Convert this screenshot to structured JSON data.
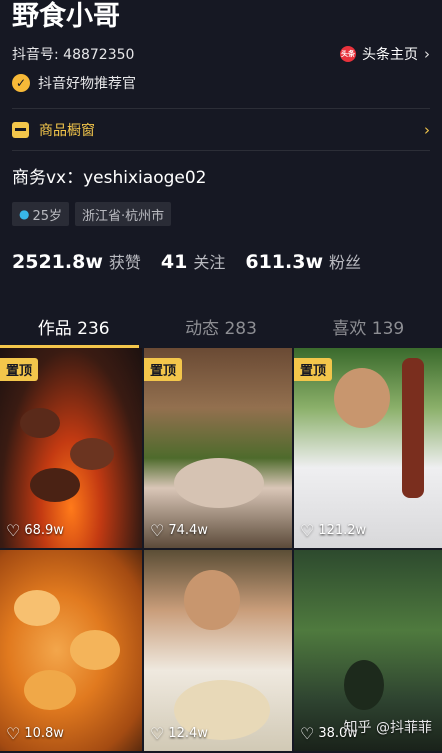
{
  "profile": {
    "name": "野食小哥",
    "account_id": "抖音号: 48872350",
    "headline_link": "头条主页",
    "toutiao_logo_text": "头条",
    "badge": "抖音好物推荐官",
    "shop": "商品橱窗",
    "bio": "商务vx：yeshixiaoge02",
    "tags": [
      "25岁",
      "浙江省·杭州市"
    ]
  },
  "stats": [
    {
      "value": "2521.8w",
      "label": "获赞"
    },
    {
      "value": "41",
      "label": "关注"
    },
    {
      "value": "611.3w",
      "label": "粉丝"
    }
  ],
  "tabs": [
    {
      "label": "作品 236",
      "active": true
    },
    {
      "label": "动态 283",
      "active": false
    },
    {
      "label": "喜欢 139",
      "active": false
    }
  ],
  "videos": [
    {
      "pinned_label": "置顶",
      "likes": "68.9w"
    },
    {
      "pinned_label": "置顶",
      "likes": "74.4w"
    },
    {
      "pinned_label": "置顶",
      "likes": "121.2w"
    },
    {
      "pinned_label": "",
      "likes": "10.8w"
    },
    {
      "pinned_label": "",
      "likes": "12.4w"
    },
    {
      "pinned_label": "",
      "likes": "38.0w"
    }
  ],
  "watermark": "知乎 @抖菲菲",
  "colors": {
    "background": "#161823",
    "accent": "#f3c64b",
    "muted": "#8d8e93"
  }
}
